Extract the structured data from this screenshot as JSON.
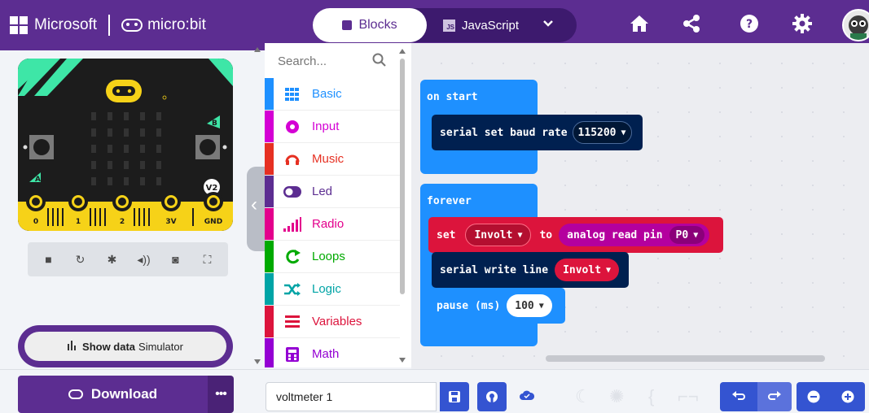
{
  "header": {
    "brand_ms": "Microsoft",
    "brand_mb": "micro:bit",
    "tabs": {
      "blocks": "Blocks",
      "javascript": "JavaScript",
      "js_badge": "JS"
    },
    "icons": [
      "home-icon",
      "share-icon",
      "help-icon",
      "settings-icon"
    ]
  },
  "simulator": {
    "pins": [
      "0",
      "1",
      "2",
      "3V",
      "GND"
    ],
    "buttons": {
      "a": "A",
      "b": "B"
    },
    "version": "V2",
    "controls": [
      "stop-icon",
      "restart-icon",
      "debug-icon",
      "mute-icon",
      "screenshot-icon",
      "fullscreen-icon"
    ],
    "show_data_bold": "Show data",
    "show_data_rest": "Simulator"
  },
  "toolbox": {
    "search_placeholder": "Search...",
    "categories": [
      {
        "label": "Basic",
        "color": "#1e90ff",
        "icon": "grid-icon"
      },
      {
        "label": "Input",
        "color": "#d400d4",
        "icon": "input-icon"
      },
      {
        "label": "Music",
        "color": "#e63022",
        "icon": "headphones-icon"
      },
      {
        "label": "Led",
        "color": "#5c2d91",
        "icon": "toggle-icon"
      },
      {
        "label": "Radio",
        "color": "#e3008c",
        "icon": "signal-icon"
      },
      {
        "label": "Loops",
        "color": "#00aa00",
        "icon": "loop-icon"
      },
      {
        "label": "Logic",
        "color": "#00a4a6",
        "icon": "shuffle-icon"
      },
      {
        "label": "Variables",
        "color": "#dc143c",
        "icon": "lines-icon"
      },
      {
        "label": "Math",
        "color": "#9400d3",
        "icon": "calculator-icon"
      }
    ]
  },
  "workspace": {
    "on_start": {
      "label": "on start",
      "serial_baud": "serial set baud rate",
      "baud_value": "115200"
    },
    "forever": {
      "label": "forever",
      "set_kw": "set",
      "set_var": "Involt",
      "to_kw": "to",
      "analog_read": "analog read pin",
      "pin": "P0",
      "serial_write": "serial write line",
      "write_var": "Involt",
      "pause_label": "pause (ms)",
      "pause_value": "100"
    }
  },
  "footer": {
    "download": "Download",
    "more": "•••",
    "project_name": "voltmeter 1"
  }
}
